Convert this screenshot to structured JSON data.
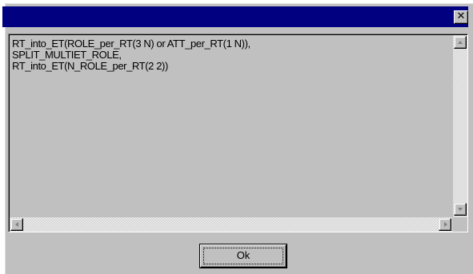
{
  "dialog": {
    "title": "",
    "close_glyph": "✕",
    "message_text": "RT_into_ET(ROLE_per_RT(3 N) or ATT_per_RT(1 N)),\nSPLIT_MULTIET_ROLE,\nRT_into_ET(N_ROLE_per_RT(2 2))",
    "ok_label": "Ok"
  },
  "colors": {
    "titlebar": "#000080",
    "face": "#c0c0c0"
  },
  "icons": {
    "close": "close-icon",
    "scroll_up": "arrow-up-icon",
    "scroll_down": "arrow-down-icon",
    "scroll_left": "arrow-left-icon",
    "scroll_right": "arrow-right-icon"
  }
}
